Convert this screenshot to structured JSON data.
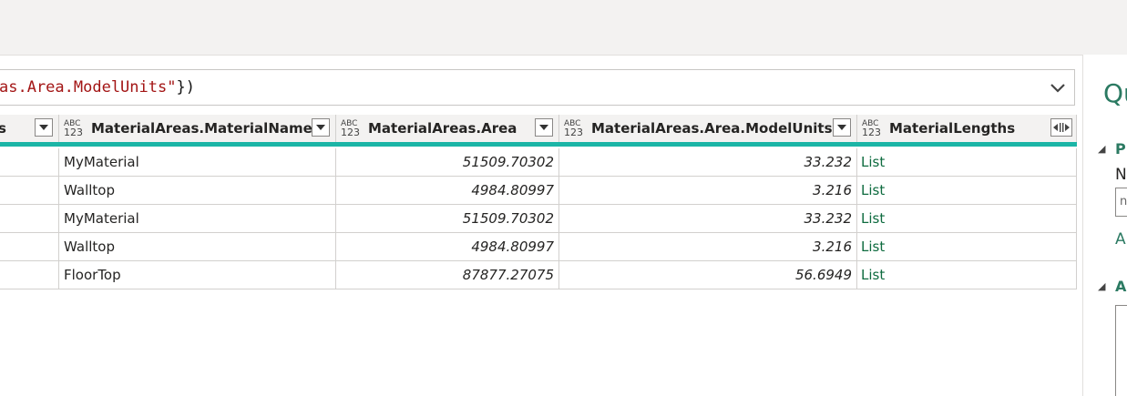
{
  "formula_bar": {
    "text_prefix": "as.Area.ModelUnits",
    "text_suffix": "})"
  },
  "columns": [
    {
      "name": "s",
      "type_top": "",
      "type_bottom": ""
    },
    {
      "name": "MaterialAreas.MaterialName",
      "type_top": "ABC",
      "type_bottom": "123"
    },
    {
      "name": "MaterialAreas.Area",
      "type_top": "ABC",
      "type_bottom": "123"
    },
    {
      "name": "MaterialAreas.Area.ModelUnits",
      "type_top": "ABC",
      "type_bottom": "123"
    },
    {
      "name": "MaterialLengths",
      "type_top": "ABC",
      "type_bottom": "123"
    }
  ],
  "rows": [
    {
      "c0": "",
      "material": "MyMaterial",
      "area": "51509.70302",
      "model_units": "33.232",
      "lengths": "List"
    },
    {
      "c0": "",
      "material": "Walltop",
      "area": "4984.80997",
      "model_units": "3.216",
      "lengths": "List"
    },
    {
      "c0": "",
      "material": "MyMaterial",
      "area": "51509.70302",
      "model_units": "33.232",
      "lengths": "List"
    },
    {
      "c0": "",
      "material": "Walltop",
      "area": "4984.80997",
      "model_units": "3.216",
      "lengths": "List"
    },
    {
      "c0": "",
      "material": "FloorTop",
      "area": "87877.27075",
      "model_units": "56.6949",
      "lengths": "List"
    }
  ],
  "right_panel": {
    "title": "Qu",
    "section1_head": "Pl",
    "name_label": "N",
    "name_input_value": "n",
    "all_link": "Al",
    "section2_head": "A"
  },
  "colors": {
    "accent_teal": "#1bb5a6",
    "link_green": "#0e6b3f",
    "panel_green": "#2b7a62",
    "string_red": "#a31515"
  }
}
